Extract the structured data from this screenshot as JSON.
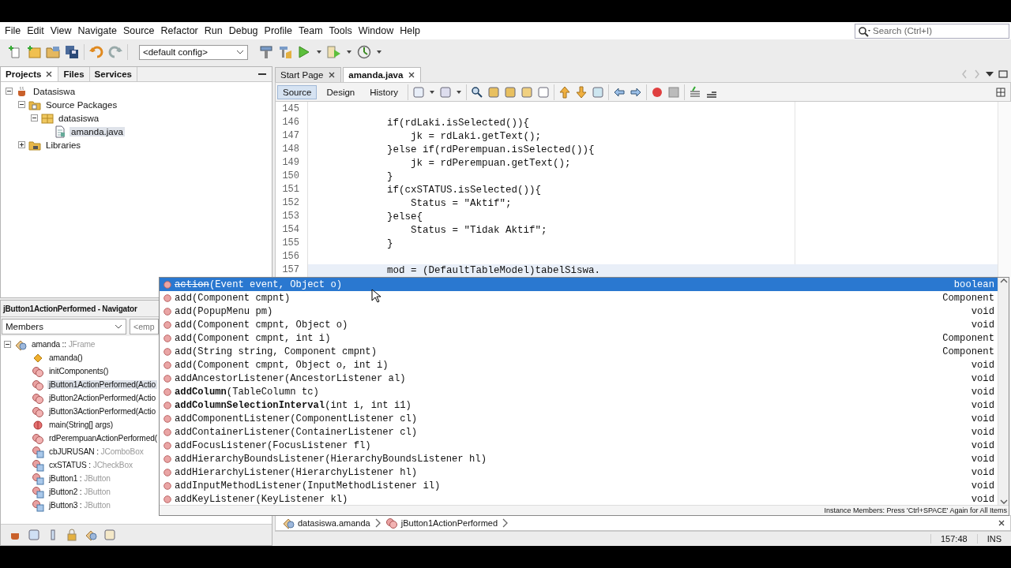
{
  "menu": [
    "File",
    "Edit",
    "View",
    "Navigate",
    "Source",
    "Refactor",
    "Run",
    "Debug",
    "Profile",
    "Team",
    "Tools",
    "Window",
    "Help"
  ],
  "search": {
    "placeholder": "Search (Ctrl+I)"
  },
  "toolbar": {
    "config": "<default config>"
  },
  "projects_panel": {
    "tabs": [
      {
        "label": "Projects",
        "selected": true,
        "closable": true
      },
      {
        "label": "Files",
        "selected": false,
        "closable": false
      },
      {
        "label": "Services",
        "selected": false,
        "closable": false
      }
    ],
    "tree": [
      {
        "label": "Datasiswa",
        "kind": "project",
        "expanded": true,
        "selected": false,
        "children": [
          {
            "label": "Source Packages",
            "kind": "source",
            "expanded": true,
            "selected": false,
            "children": [
              {
                "label": "datasiswa",
                "kind": "package",
                "expanded": true,
                "selected": false,
                "children": [
                  {
                    "label": "amanda.java",
                    "kind": "file",
                    "selected": true
                  }
                ]
              }
            ]
          },
          {
            "label": "Libraries",
            "kind": "library",
            "expanded": false,
            "selected": false
          }
        ]
      }
    ]
  },
  "navigator": {
    "title": "jButton1ActionPerformed - Navigator",
    "filter": "Members",
    "second_filter": "<emp",
    "tree": [
      {
        "label": "amanda ::",
        "detail": "JFrame",
        "kind": "class",
        "expanded": true,
        "selected": false,
        "children": [
          {
            "label": "amanda()",
            "kind": "constructor",
            "selected": false
          },
          {
            "label": "initComponents()",
            "kind": "method",
            "selected": false
          },
          {
            "label": "jButton1ActionPerformed(Actio",
            "kind": "method",
            "selected": true
          },
          {
            "label": "jButton2ActionPerformed(Actio",
            "kind": "method",
            "selected": false
          },
          {
            "label": "jButton3ActionPerformed(Actio",
            "kind": "method",
            "selected": false
          },
          {
            "label": "main(String[] args)",
            "kind": "static",
            "selected": false
          },
          {
            "label": "rdPerempuanActionPerformed(",
            "kind": "method",
            "selected": false
          },
          {
            "label": "cbJURUSAN :",
            "detail": "JComboBox",
            "kind": "field",
            "selected": false
          },
          {
            "label": "cxSTATUS :",
            "detail": "JCheckBox",
            "kind": "field",
            "selected": false
          },
          {
            "label": "jButton1 :",
            "detail": "JButton",
            "kind": "field",
            "selected": false
          },
          {
            "label": "jButton2 :",
            "detail": "JButton",
            "kind": "field",
            "selected": false
          },
          {
            "label": "jButton3 :",
            "detail": "JButton",
            "kind": "field",
            "selected": false
          }
        ]
      }
    ]
  },
  "editor": {
    "tabs": [
      {
        "label": "Start Page",
        "selected": false
      },
      {
        "label": "amanda.java",
        "selected": true
      }
    ],
    "views": [
      {
        "label": "Source",
        "selected": true
      },
      {
        "label": "Design",
        "selected": false
      },
      {
        "label": "History",
        "selected": false
      }
    ],
    "lines": [
      {
        "number": "145",
        "current": false
      },
      {
        "number": "146",
        "text": "            if(rdLaki.isSelected()){",
        "current": false
      },
      {
        "number": "147",
        "text": "                jk = rdLaki.getText();",
        "current": false
      },
      {
        "number": "148",
        "text": "            }else if(rdPerempuan.isSelected()){",
        "current": false
      },
      {
        "number": "149",
        "text": "                jk = rdPerempuan.getText();",
        "current": false
      },
      {
        "number": "150",
        "text": "            }",
        "current": false
      },
      {
        "number": "151",
        "text": "            if(cxSTATUS.isSelected()){",
        "current": false
      },
      {
        "number": "152",
        "text": "                Status = \"Aktif\";",
        "current": false
      },
      {
        "number": "153",
        "text": "            }else{",
        "current": false
      },
      {
        "number": "154",
        "text": "                Status = \"Tidak Aktif\";",
        "current": false
      },
      {
        "number": "155",
        "text": "            }",
        "current": false
      },
      {
        "number": "156",
        "current": false
      },
      {
        "number": "157",
        "text": "            mod = (DefaultTableModel)tabelSiswa.",
        "current": true
      }
    ],
    "breadcrumb": [
      {
        "label": "datasiswa.amanda",
        "kind": "class"
      },
      {
        "label": "jButton1ActionPerformed",
        "kind": "method"
      }
    ]
  },
  "completion": {
    "items": [
      {
        "method": "action",
        "params": "(Event event, Object o)",
        "returns": "boolean",
        "selected": true,
        "bold": false,
        "deprecated": true
      },
      {
        "method": "add",
        "params": "(Component cmpnt)",
        "returns": "Component",
        "selected": false,
        "bold": false,
        "deprecated": false
      },
      {
        "method": "add",
        "params": "(PopupMenu pm)",
        "returns": "void",
        "selected": false,
        "bold": false,
        "deprecated": false
      },
      {
        "method": "add",
        "params": "(Component cmpnt, Object o)",
        "returns": "void",
        "selected": false,
        "bold": false,
        "deprecated": false
      },
      {
        "method": "add",
        "params": "(Component cmpnt, int i)",
        "returns": "Component",
        "selected": false,
        "bold": false,
        "deprecated": false
      },
      {
        "method": "add",
        "params": "(String string, Component cmpnt)",
        "returns": "Component",
        "selected": false,
        "bold": false,
        "deprecated": false
      },
      {
        "method": "add",
        "params": "(Component cmpnt, Object o, int i)",
        "returns": "void",
        "selected": false,
        "bold": false,
        "deprecated": false
      },
      {
        "method": "addAncestorListener",
        "params": "(AncestorListener al)",
        "returns": "void",
        "selected": false,
        "bold": false,
        "deprecated": false
      },
      {
        "method": "addColumn",
        "params": "(TableColumn tc)",
        "returns": "void",
        "selected": false,
        "bold": true,
        "deprecated": false
      },
      {
        "method": "addColumnSelectionInterval",
        "params": "(int i, int i1)",
        "returns": "void",
        "selected": false,
        "bold": true,
        "deprecated": false
      },
      {
        "method": "addComponentListener",
        "params": "(ComponentListener cl)",
        "returns": "void",
        "selected": false,
        "bold": false,
        "deprecated": false
      },
      {
        "method": "addContainerListener",
        "params": "(ContainerListener cl)",
        "returns": "void",
        "selected": false,
        "bold": false,
        "deprecated": false
      },
      {
        "method": "addFocusListener",
        "params": "(FocusListener fl)",
        "returns": "void",
        "selected": false,
        "bold": false,
        "deprecated": false
      },
      {
        "method": "addHierarchyBoundsListener",
        "params": "(HierarchyBoundsListener hl)",
        "returns": "void",
        "selected": false,
        "bold": false,
        "deprecated": false
      },
      {
        "method": "addHierarchyListener",
        "params": "(HierarchyListener hl)",
        "returns": "void",
        "selected": false,
        "bold": false,
        "deprecated": false
      },
      {
        "method": "addInputMethodListener",
        "params": "(InputMethodListener il)",
        "returns": "void",
        "selected": false,
        "bold": false,
        "deprecated": false
      },
      {
        "method": "addKeyListener",
        "params": "(KeyListener kl)",
        "returns": "void",
        "selected": false,
        "bold": false,
        "deprecated": false
      }
    ],
    "hint": "Instance Members: Press 'Ctrl+SPACE' Again for All Items"
  },
  "status_bar": {
    "position": "157:48",
    "mode": "INS"
  }
}
